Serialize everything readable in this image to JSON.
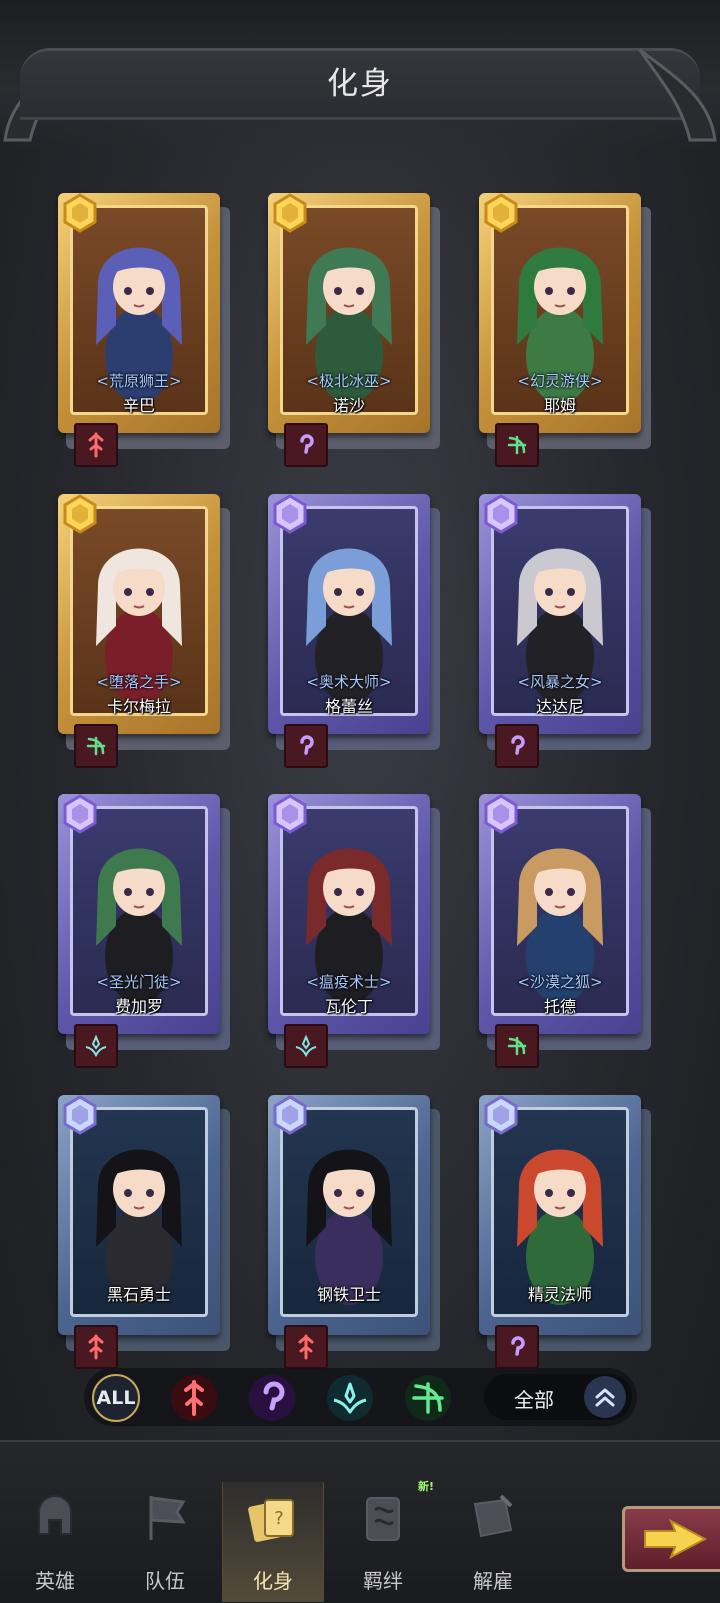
{
  "header": {
    "title": "化身"
  },
  "cards": [
    {
      "name": "辛巴",
      "epithet": "<荒原狮王>",
      "rarity": "gold",
      "class_icon": "warrior-class-icon",
      "class_color": "#ff6a6a",
      "hair": "#5b5fb8",
      "outfit": "#2c3e70"
    },
    {
      "name": "诺沙",
      "epithet": "<极北冰巫>",
      "rarity": "gold",
      "class_icon": "mage-class-icon",
      "class_color": "#c69cff",
      "hair": "#3f7a55",
      "outfit": "#2d5b3c"
    },
    {
      "name": "耶姆",
      "epithet": "<幻灵游侠>",
      "rarity": "gold",
      "class_icon": "ranger-class-icon",
      "class_color": "#5fe08a",
      "hair": "#2f7a3e",
      "outfit": "#3d7a44"
    },
    {
      "name": "卡尔梅拉",
      "epithet": "<堕落之手>",
      "rarity": "gold",
      "class_icon": "ranger-class-icon",
      "class_color": "#5fe08a",
      "hair": "#efe6df",
      "outfit": "#7a1f2a"
    },
    {
      "name": "格蕾丝",
      "epithet": "<奥术大师>",
      "rarity": "purple",
      "class_icon": "mage-class-icon",
      "class_color": "#c69cff",
      "hair": "#7b9ed8",
      "outfit": "#222226"
    },
    {
      "name": "达达尼",
      "epithet": "<风暴之女>",
      "rarity": "purple",
      "class_icon": "mage-class-icon",
      "class_color": "#c69cff",
      "hair": "#c9c9cf",
      "outfit": "#222226"
    },
    {
      "name": "费加罗",
      "epithet": "<圣光门徒>",
      "rarity": "purple",
      "class_icon": "priest-class-icon",
      "class_color": "#7fe6e0",
      "hair": "#3e7a4e",
      "outfit": "#1e1e22"
    },
    {
      "name": "瓦伦丁",
      "epithet": "<瘟疫术士>",
      "rarity": "purple",
      "class_icon": "priest-class-icon",
      "class_color": "#7fe6e0",
      "hair": "#7a2a2a",
      "outfit": "#1e1e22"
    },
    {
      "name": "托德",
      "epithet": "<沙漠之狐>",
      "rarity": "purple",
      "class_icon": "ranger-class-icon",
      "class_color": "#5fe08a",
      "hair": "#c99a62",
      "outfit": "#23406e"
    },
    {
      "name": "黑石勇士",
      "epithet": "",
      "rarity": "blue",
      "class_icon": "warrior-class-icon",
      "class_color": "#ff6a6a",
      "hair": "#141418",
      "outfit": "#2a2a30"
    },
    {
      "name": "钢铁卫士",
      "epithet": "",
      "rarity": "blue",
      "class_icon": "warrior-class-icon",
      "class_color": "#ff6a6a",
      "hair": "#141418",
      "outfit": "#3a2e5e"
    },
    {
      "name": "精灵法师",
      "epithet": "",
      "rarity": "blue",
      "class_icon": "mage-class-icon",
      "class_color": "#c69cff",
      "hair": "#c9482e",
      "outfit": "#2f6b3a"
    }
  ],
  "filters": {
    "all_label": "ALL",
    "classes": [
      "warrior-class-icon",
      "mage-class-icon",
      "priest-class-icon",
      "ranger-class-icon"
    ],
    "sort_label": "全部",
    "sort_icon": "double-chevron-up-icon"
  },
  "nav": {
    "items": [
      {
        "label": "英雄",
        "icon": "helmet-icon"
      },
      {
        "label": "队伍",
        "icon": "flag-icon"
      },
      {
        "label": "化身",
        "icon": "cards-icon",
        "active": true
      },
      {
        "label": "羁绊",
        "icon": "book-icon"
      },
      {
        "label": "解雇",
        "icon": "scroll-icon"
      }
    ],
    "new_badge": "新!",
    "next_icon": "arrow-right-icon"
  }
}
